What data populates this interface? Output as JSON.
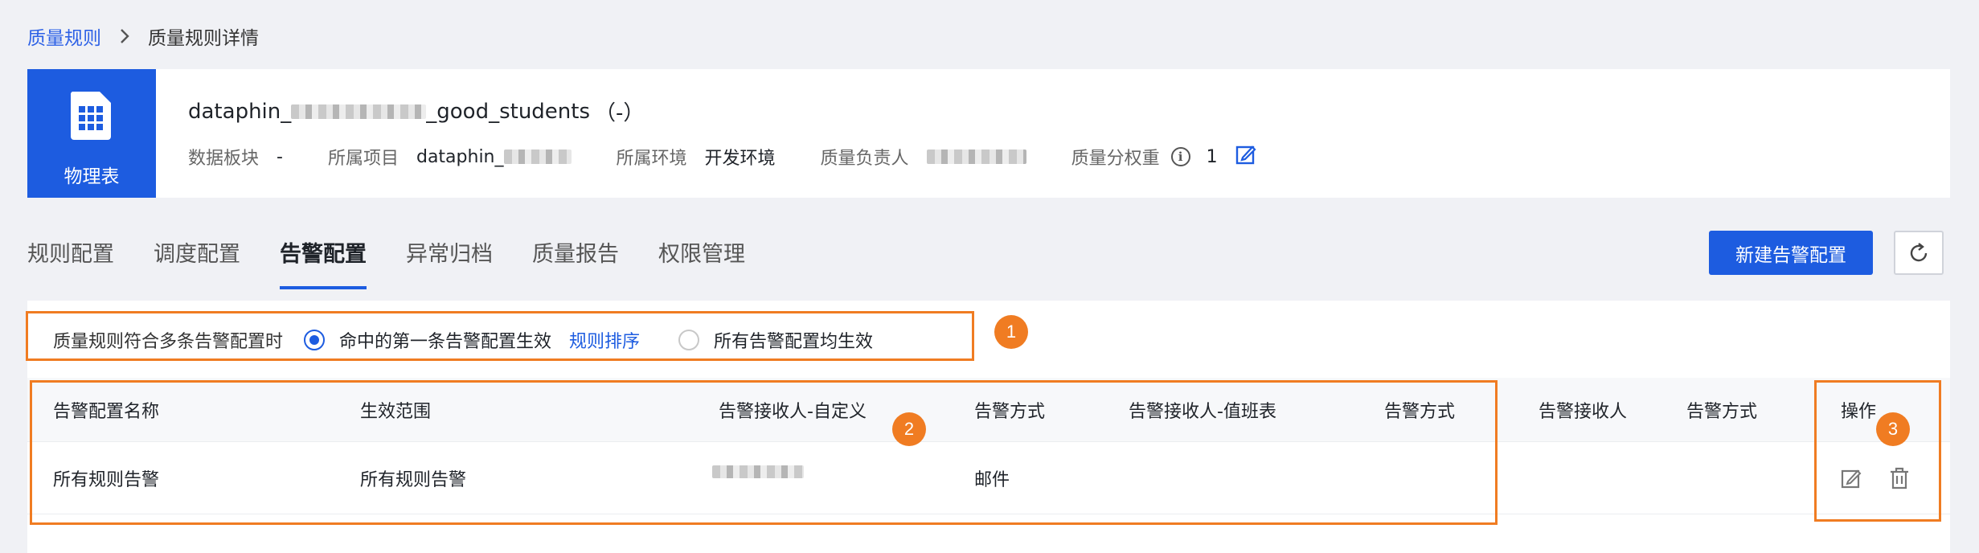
{
  "breadcrumb": {
    "root": "质量规则",
    "current": "质量规则详情"
  },
  "header": {
    "type_label": "物理表",
    "table_name_prefix": "dataphin_",
    "table_name_suffix": "_good_students",
    "table_name_extra": "（-）",
    "meta": [
      {
        "label": "数据板块",
        "value": "-"
      },
      {
        "label": "所属项目",
        "value": "dataphin_"
      },
      {
        "label": "所属环境",
        "value": "开发环境"
      },
      {
        "label": "质量负责人",
        "value": ""
      },
      {
        "label": "质量分权重",
        "value": "1"
      }
    ],
    "info_icon": "i"
  },
  "tabs": [
    {
      "label": "规则配置",
      "active": false
    },
    {
      "label": "调度配置",
      "active": false
    },
    {
      "label": "告警配置",
      "active": true
    },
    {
      "label": "异常归档",
      "active": false
    },
    {
      "label": "质量报告",
      "active": false
    },
    {
      "label": "权限管理",
      "active": false
    }
  ],
  "actions": {
    "new_alert": "新建告警配置"
  },
  "policy": {
    "label": "质量规则符合多条告警配置时",
    "option_first": "命中的第一条告警配置生效",
    "sort_link": "规则排序",
    "option_all": "所有告警配置均生效",
    "selected": "option_first"
  },
  "table": {
    "columns": [
      "告警配置名称",
      "生效范围",
      "告警接收人-自定义",
      "告警方式",
      "告警接收人-值班表",
      "告警方式",
      "告警接收人",
      "告警方式",
      "操作"
    ],
    "rows": [
      {
        "name": "所有规则告警",
        "scope": "所有规则告警",
        "custom_receiver": "",
        "method1": "邮件",
        "duty_receiver": "",
        "method2": "",
        "receiver": "",
        "method3": ""
      }
    ]
  },
  "annotations": [
    "1",
    "2",
    "3"
  ],
  "colors": {
    "primary": "#1d5ce0",
    "annotation": "#f07c22",
    "background": "#f0f1f5"
  },
  "icons": [
    "chevron-right-icon",
    "table-grid-icon",
    "info-icon",
    "edit-icon",
    "refresh-icon",
    "delete-icon"
  ]
}
